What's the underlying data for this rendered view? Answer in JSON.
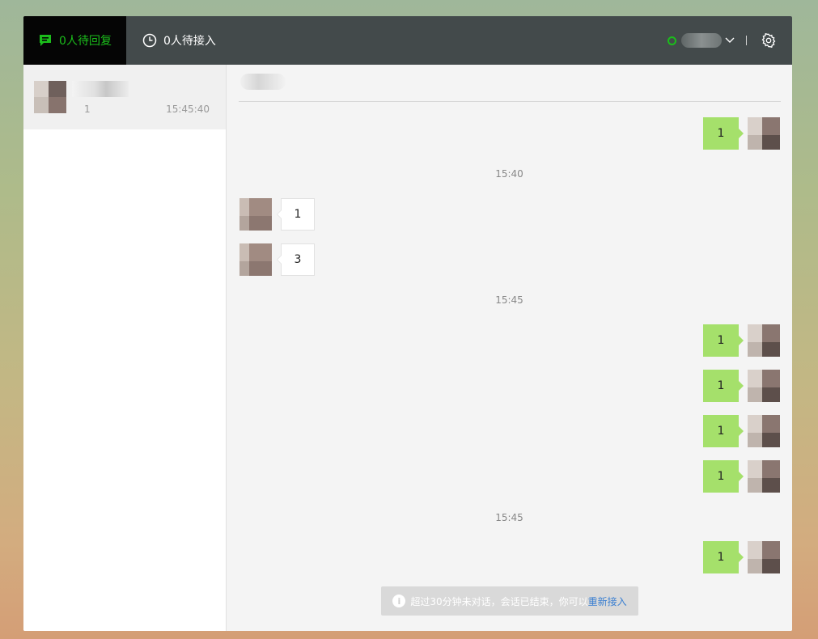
{
  "header": {
    "tabs": [
      {
        "label": "0人待回复",
        "icon": "chat-bubble-icon"
      },
      {
        "label": "0人待接入",
        "icon": "clock-icon"
      }
    ],
    "status": "online",
    "colors": {
      "accent": "#1bbd1b",
      "topbar": "#434a4b"
    }
  },
  "sessions": [
    {
      "preview": "1",
      "time": "15:45:40"
    }
  ],
  "chat": {
    "timestamps": [
      "15:40",
      "15:45",
      "15:45"
    ],
    "messages": [
      {
        "dir": "out",
        "text": "1"
      },
      {
        "dir": "in",
        "text": "1"
      },
      {
        "dir": "in",
        "text": "3"
      },
      {
        "dir": "out",
        "text": "1"
      },
      {
        "dir": "out",
        "text": "1"
      },
      {
        "dir": "out",
        "text": "1"
      },
      {
        "dir": "out",
        "text": "1"
      },
      {
        "dir": "out",
        "text": "1"
      }
    ],
    "notice": {
      "text": "超过30分钟未对话，会话已结束，你可以",
      "link": "重新接入"
    }
  }
}
